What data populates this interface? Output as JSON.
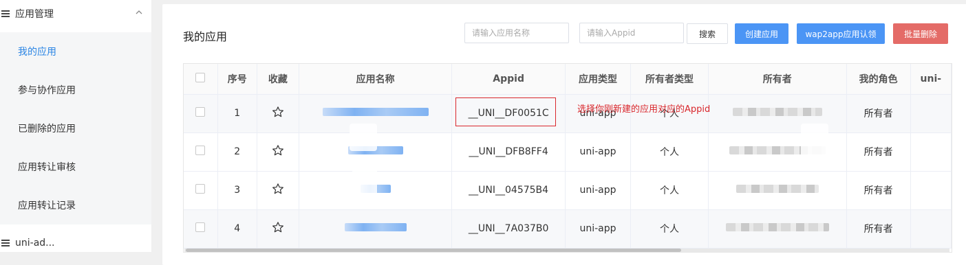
{
  "sidebar": {
    "group1": "应用管理",
    "items": [
      {
        "label": "我的应用",
        "active": true
      },
      {
        "label": "参与协作应用"
      },
      {
        "label": "已删除的应用"
      },
      {
        "label": "应用转让审核"
      },
      {
        "label": "应用转让记录"
      }
    ],
    "group2": "uni-ad..."
  },
  "main": {
    "title": "我的应用",
    "search_name_placeholder": "请输入应用名称",
    "search_appid_placeholder": "请输入Appid",
    "search_btn": "搜索",
    "create_btn": "创建应用",
    "wap2app_btn": "wap2app应用认领",
    "batch_delete_btn": "批量删除"
  },
  "table": {
    "headers": [
      "序号",
      "收藏",
      "应用名称",
      "Appid",
      "应用类型",
      "所有者类型",
      "所有者",
      "我的角色",
      "uni-"
    ],
    "rows": [
      {
        "no": "1",
        "appid": "__UNI__DF0051C",
        "type": "uni-app",
        "owner_type": "个人",
        "role": "所有者"
      },
      {
        "no": "2",
        "appid": "__UNI__DFB8FF4",
        "type": "uni-app",
        "owner_type": "个人",
        "role": "所有者"
      },
      {
        "no": "3",
        "appid": "__UNI__04575B4",
        "type": "uni-app",
        "owner_type": "个人",
        "role": "所有者"
      },
      {
        "no": "4",
        "appid": "__UNI__7A037B0",
        "type": "uni-app",
        "owner_type": "个人",
        "role": "所有者"
      }
    ]
  },
  "annotation": "选择你刚新建的应用对应的Appid",
  "colors": {
    "accent": "#2b85e4",
    "primary_button": "#4b95f5",
    "danger_button": "#e46b67",
    "annotation": "#d9262b"
  }
}
